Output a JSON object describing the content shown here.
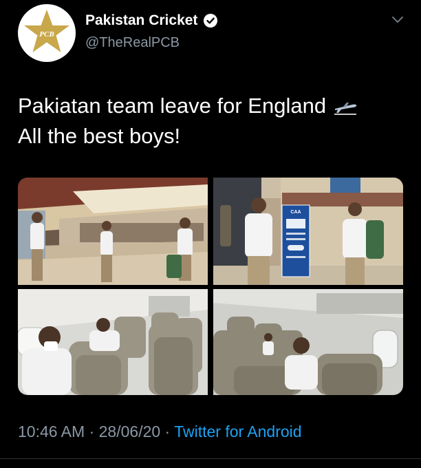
{
  "account": {
    "display_name": "Pakistan Cricket",
    "handle": "@TheRealPCB",
    "logo_text": "PCB",
    "verified": true,
    "avatar_icon": "pcb-star-logo-icon"
  },
  "tweet": {
    "line1": "Pakiatan team leave for England",
    "line2": "All the best boys!",
    "emoji_icon": "airplane-departure-icon",
    "photos": [
      {
        "name": "airport-terminal-photo"
      },
      {
        "name": "airport-boarding-photo"
      },
      {
        "name": "plane-cabin-photo-left"
      },
      {
        "name": "plane-cabin-photo-right"
      }
    ],
    "sign_text": "CAA"
  },
  "meta": {
    "time": "10:46 AM",
    "separator": " · ",
    "date": "28/06/20",
    "separator2": " · ",
    "source": "Twitter for Android"
  },
  "colors": {
    "background": "#000000",
    "text": "#ffffff",
    "muted": "#8b98a5",
    "link": "#1da1f2",
    "logo_gold": "#c9a74b"
  }
}
